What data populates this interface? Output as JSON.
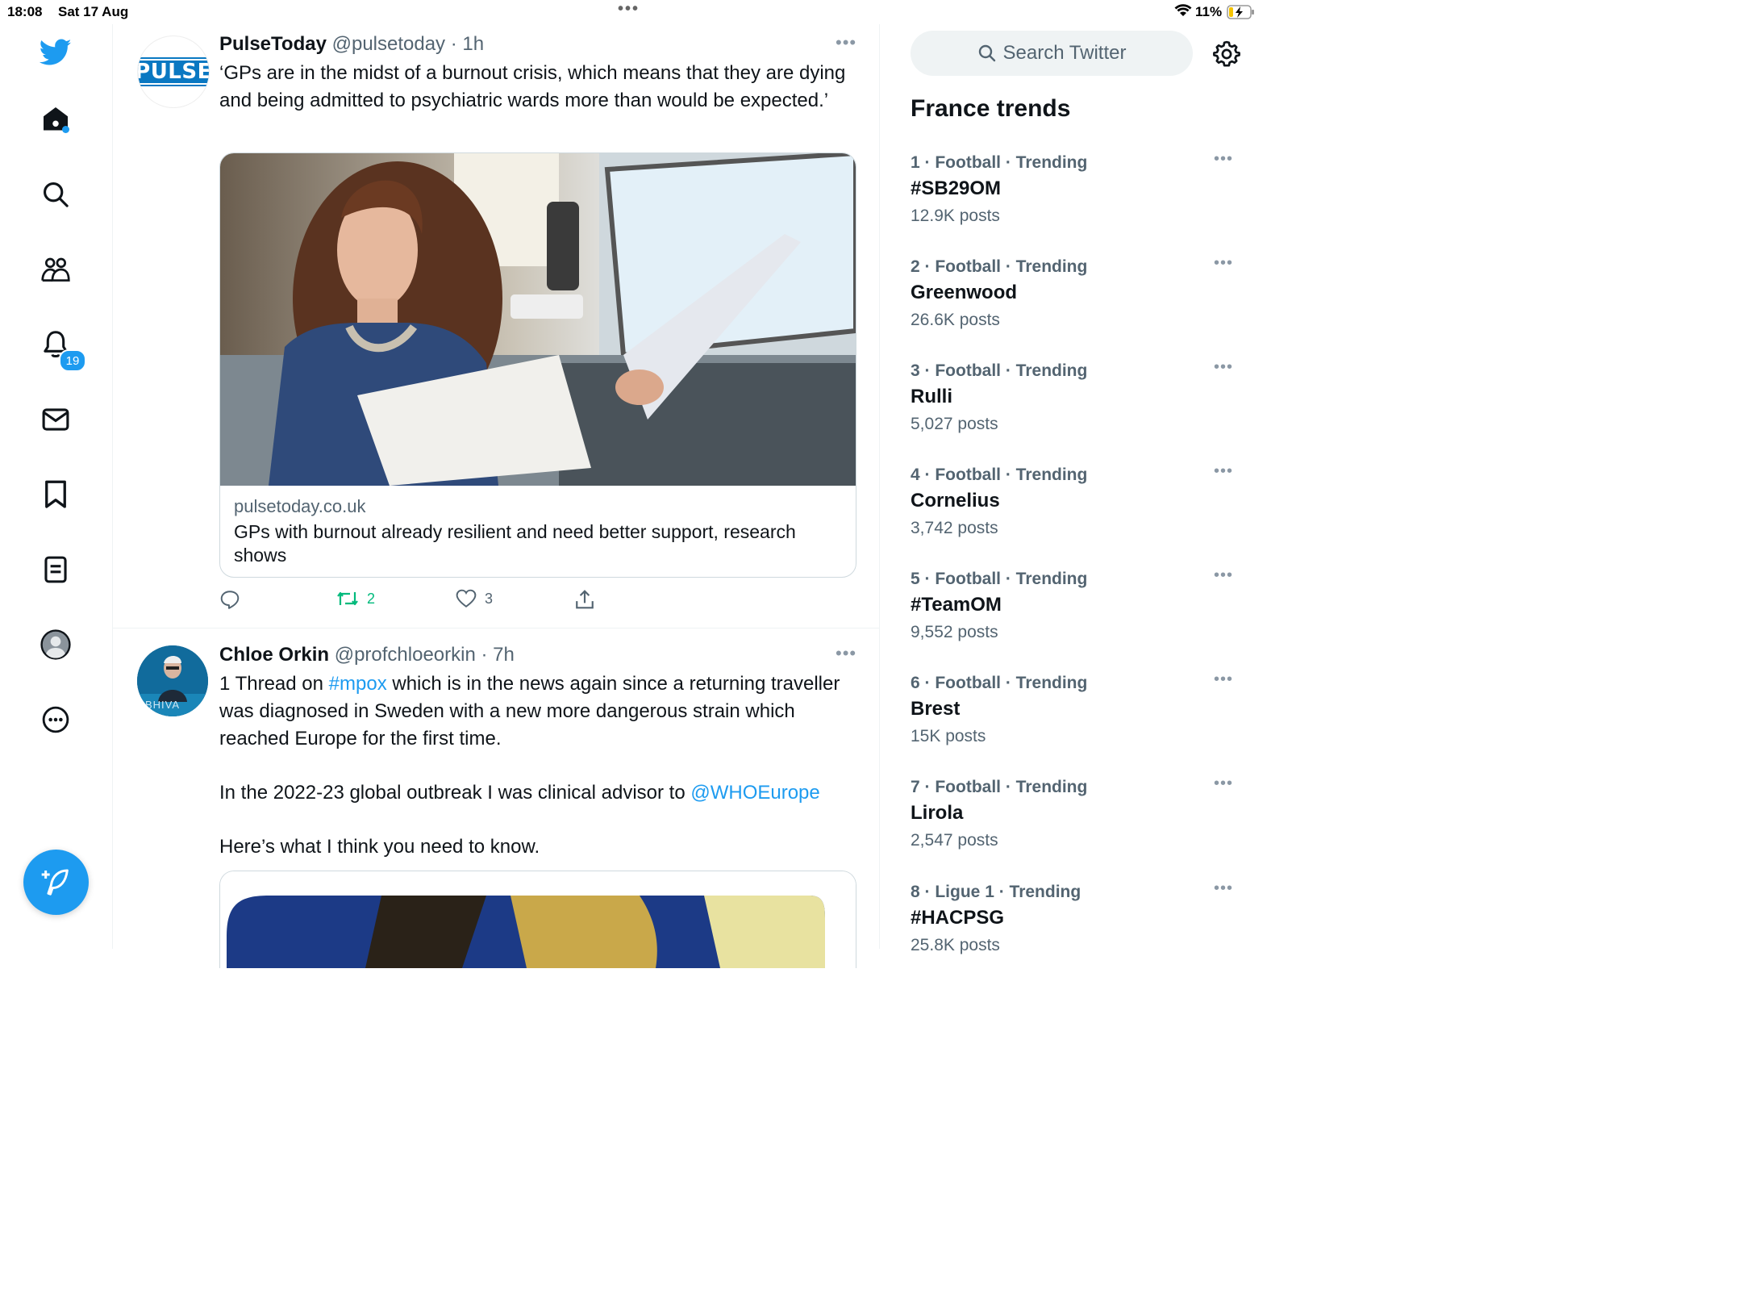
{
  "status_bar": {
    "time": "18:08",
    "date": "Sat 17 Aug",
    "battery": "11%"
  },
  "nav": {
    "icons": [
      "twitter-bird-icon",
      "home-icon",
      "search-icon",
      "communities-icon",
      "bell-icon",
      "mail-icon",
      "bookmark-icon",
      "lists-icon",
      "profile-icon",
      "more-icon"
    ],
    "notifications_badge": "19"
  },
  "colors": {
    "accent": "#1d9bf0",
    "retweet": "#00ba7c",
    "muted": "#536471"
  },
  "tweets": [
    {
      "name": "PulseToday",
      "handle": "@pulsetoday",
      "time": "1h",
      "avatar_text": "PULSE",
      "text": "‘GPs are in the midst of a burnout crisis, which means that they are dying and being admitted to psychiatric wards more than would be expected.’",
      "card": {
        "domain": "pulsetoday.co.uk",
        "title": "GPs with burnout already resilient and need better support, research shows"
      },
      "retweets": "2",
      "likes": "3"
    },
    {
      "name": "Chloe Orkin",
      "handle": "@profchloeorkin",
      "time": "7h",
      "avatar_text": "BHIVA",
      "text_parts": {
        "p1_a": "1 Thread on ",
        "p1_link": "#mpox",
        "p1_b": " which is in the news again since a returning traveller was diagnosed in Sweden with a new more dangerous strain which reached Europe for the first time.",
        "p2_a": "In the 2022-23 global outbreak I was clinical advisor to ",
        "p2_link": "@WHOEurope",
        "p3": "Here’s what I think you need to know."
      }
    }
  ],
  "search": {
    "placeholder": "Search Twitter"
  },
  "trends": {
    "title": "France trends",
    "items": [
      {
        "num": "1",
        "category": "Football · Trending",
        "name": "#SB29OM",
        "count": "12.9K posts"
      },
      {
        "num": "2",
        "category": "Football · Trending",
        "name": "Greenwood",
        "count": "26.6K posts"
      },
      {
        "num": "3",
        "category": "Football · Trending",
        "name": "Rulli",
        "count": "5,027 posts"
      },
      {
        "num": "4",
        "category": "Football · Trending",
        "name": "Cornelius",
        "count": "3,742 posts"
      },
      {
        "num": "5",
        "category": "Football · Trending",
        "name": "#TeamOM",
        "count": "9,552 posts"
      },
      {
        "num": "6",
        "category": "Football · Trending",
        "name": "Brest",
        "count": "15K posts"
      },
      {
        "num": "7",
        "category": "Football · Trending",
        "name": "Lirola",
        "count": "2,547 posts"
      },
      {
        "num": "8",
        "category": "Ligue 1 · Trending",
        "name": "#HACPSG",
        "count": "25.8K posts"
      }
    ]
  }
}
